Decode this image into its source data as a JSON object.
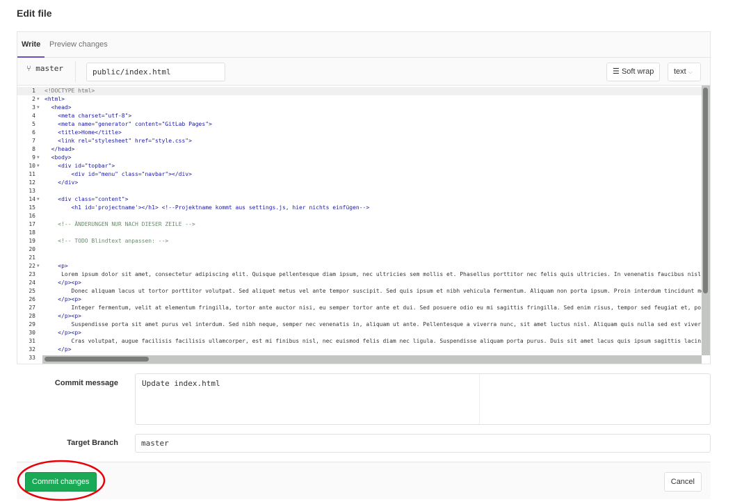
{
  "page": {
    "title": "Edit file"
  },
  "tabs": [
    {
      "label": "Write",
      "active": true
    },
    {
      "label": "Preview changes",
      "active": false
    }
  ],
  "toolbar": {
    "branch": "master",
    "branch_icon": "branch-icon",
    "file_path": "public/index.html",
    "soft_wrap_label": "Soft wrap",
    "soft_wrap_icon": "soft-wrap-icon",
    "mode": "text"
  },
  "editor": {
    "lines": [
      "<!DOCTYPE html>",
      "<html>",
      "  <head>",
      "    <meta charset=\"utf-8\">",
      "    <meta name=\"generator\" content=\"GitLab Pages\">",
      "    <title>Home</title>",
      "    <link rel=\"stylesheet\" href=\"style.css\">",
      "  </head>",
      "  <body>",
      "    <div id=\"topbar\">",
      "        <div id=\"menu\" class=\"navbar\"></div>",
      "    </div>",
      "",
      "    <div class=\"content\">",
      "        <h1 id='projectname'></h1> <!--Projektname kommt aus settings.js, hier nichts einfügen-->",
      "",
      "    <!-- ÄNDERUNGEN NUR NACH DIESER ZEILE -->",
      "",
      "    <!-- TODO Blindtext anpassen: -->",
      "",
      "",
      "    <p>",
      "     Lorem ipsum dolor sit amet, consectetur adipiscing elit. Quisque pellentesque diam ipsum, nec ultricies sem mollis et. Phasellus porttitor nec felis quis ultricies. In venenatis faucibus nisl",
      "    </p><p>",
      "        Donec aliquam lacus ut tortor porttitor volutpat. Sed aliquet metus vel ante tempor suscipit. Sed quis ipsum et nibh vehicula fermentum. Aliquam non porta ipsum. Proin interdum tincidunt me",
      "    </p><p>",
      "        Integer fermentum, velit at elementum fringilla, tortor ante auctor nisi, eu semper tortor ante et dui. Sed posuere odio eu mi sagittis fringilla. Sed enim risus, tempor sed feugiat et, pos",
      "    </p><p>",
      "        Suspendisse porta sit amet purus vel interdum. Sed nibh neque, semper nec venenatis in, aliquam ut ante. Pellentesque a viverra nunc, sit amet luctus nisl. Aliquam quis nulla sed est viverr",
      "    </p><p>",
      "        Cras volutpat, augue facilisis facilisis ullamcorper, est mi finibus nisl, nec euismod felis diam nec ligula. Suspendisse aliquam porta purus. Duis sit amet lacus quis ipsum sagittis lacini",
      "    </p>",
      ""
    ],
    "foldable_lines": [
      2,
      3,
      9,
      10,
      14,
      22
    ]
  },
  "commit": {
    "message_label": "Commit message",
    "message": "Update index.html",
    "target_label": "Target Branch",
    "target_branch": "master",
    "commit_label": "Commit changes",
    "cancel_label": "Cancel"
  },
  "colors": {
    "commit_button": "#1aaa55",
    "annotation_ring": "#e8000b",
    "active_tab_underline": "#6b4fbb"
  }
}
